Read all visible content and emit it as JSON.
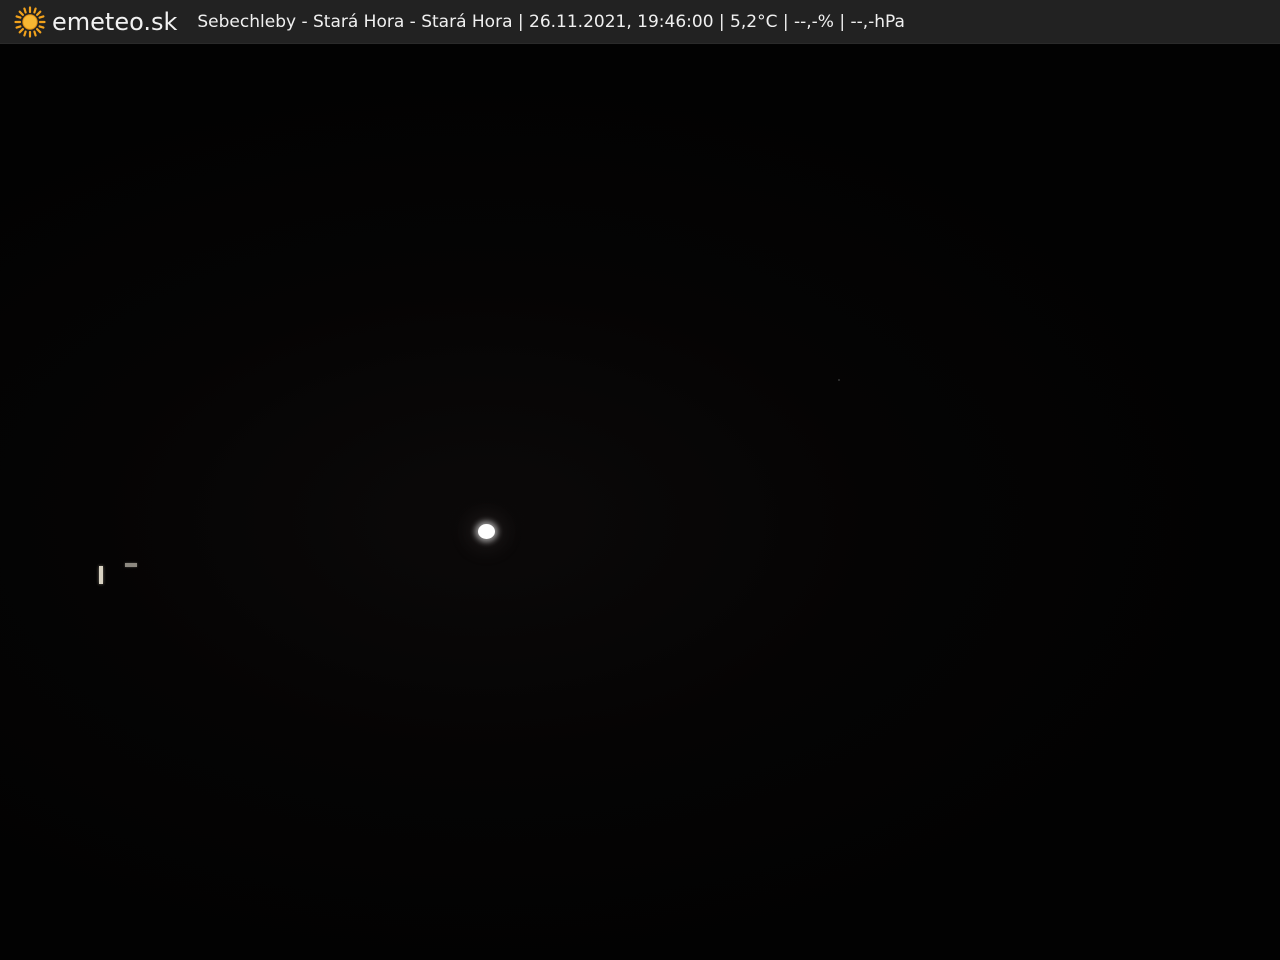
{
  "header": {
    "brand": "emeteo.sk",
    "caption": "Sebechleby - Stará Hora - Stará Hora | 26.11.2021, 19:46:00 | 5,2°C | --,-% | --,-hPa",
    "logo_icon": "sun-icon"
  },
  "colors": {
    "bar_background": "#222222",
    "sun": "#f2a21c",
    "text": "#f0f0f0",
    "scene": "#030303"
  }
}
